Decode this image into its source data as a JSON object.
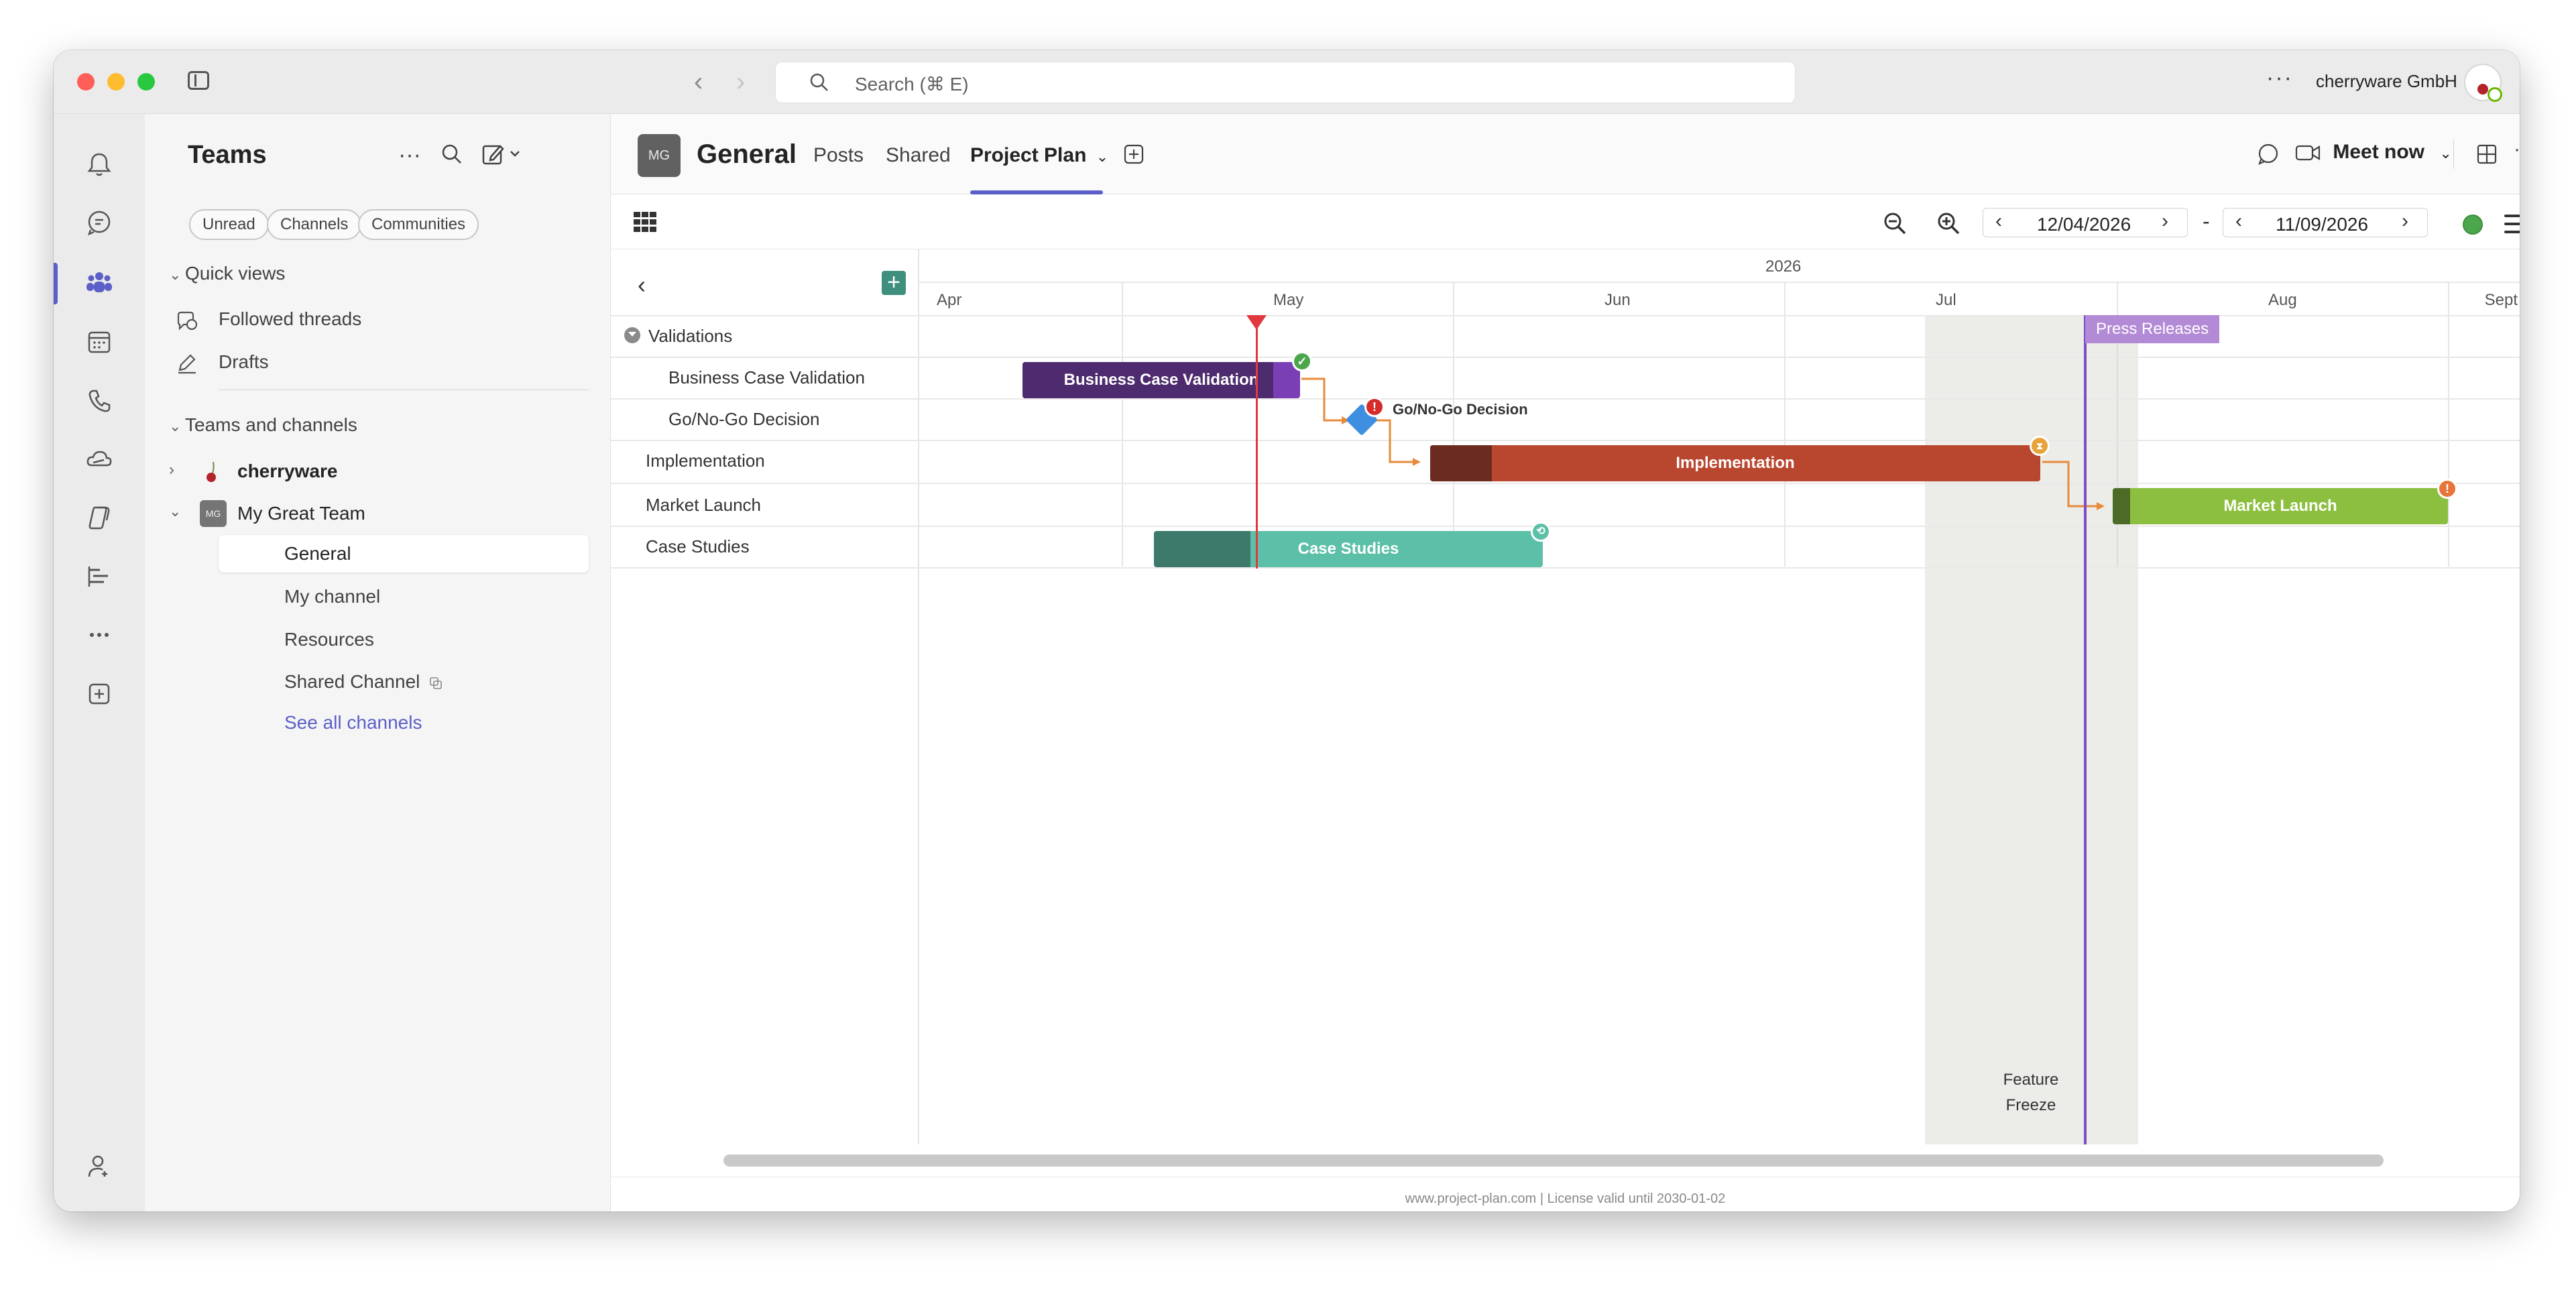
{
  "titlebar": {
    "search_placeholder": "Search (⌘ E)",
    "org_name": "cherryware GmbH",
    "more": "···"
  },
  "rail": {
    "items": [
      "Activity",
      "Chat",
      "Teams",
      "Calendar",
      "Calls",
      "OneDrive",
      "Copilot",
      "Planner",
      "More apps",
      "Apps",
      "Help"
    ],
    "active": "Teams",
    "accent": "#5b5fc7"
  },
  "teams_panel": {
    "title": "Teams",
    "filters": [
      "Unread",
      "Channels",
      "Communities"
    ],
    "quick_views": {
      "heading": "Quick views",
      "items": [
        "Followed threads",
        "Drafts"
      ]
    },
    "teams_and_channels": {
      "heading": "Teams and channels",
      "teams": [
        {
          "name": "cherryware",
          "expanded": false
        },
        {
          "name": "My Great Team",
          "badge": "MG",
          "expanded": true,
          "channels": [
            "General",
            "My channel",
            "Resources",
            "Shared Channel"
          ]
        }
      ],
      "see_all": "See all channels",
      "selected_channel": "General"
    }
  },
  "channel": {
    "avatar": "MG",
    "title": "General",
    "tabs": [
      "Posts",
      "Shared",
      "Project Plan"
    ],
    "active_tab": "Project Plan",
    "meet_now": "Meet now"
  },
  "toolbar": {
    "start_date": "12/04/2026",
    "end_date": "11/09/2026",
    "separator": "-",
    "status_color": "#4ca64c"
  },
  "gantt": {
    "year": "2026",
    "months": [
      "Apr",
      "May",
      "Jun",
      "Jul",
      "Aug",
      "Sept"
    ],
    "tasks": [
      {
        "name": "Validations",
        "type": "group"
      },
      {
        "name": "Business Case Validation",
        "type": "task",
        "bar_label": "Business Case Validation",
        "color": "#7b3fb5",
        "done_color": "#4e2a6e",
        "status": "complete"
      },
      {
        "name": "Go/No-Go Decision",
        "type": "milestone",
        "bar_label": "Go/No-Go Decision",
        "color": "#3f8fe0",
        "status": "alert"
      },
      {
        "name": "Implementation",
        "type": "task",
        "bar_label": "Implementation",
        "color": "#b9472f",
        "done_color": "#6b2b20",
        "status": "in-review"
      },
      {
        "name": "Market Launch",
        "type": "task",
        "bar_label": "Market Launch",
        "color": "#8cbf3f",
        "done_color": "#4d6b26",
        "status": "warning"
      },
      {
        "name": "Case Studies",
        "type": "task",
        "bar_label": "Case Studies",
        "color": "#5cc0a8",
        "done_color": "#3e7a6c",
        "status": "linked"
      }
    ],
    "markers": {
      "press_releases": "Press Releases",
      "feature_freeze": [
        "Feature",
        "Freeze"
      ]
    },
    "colors": {
      "today": "#e0393e",
      "press_release": "#7a4fc9",
      "dependency": "#e88a3a"
    }
  },
  "footer": {
    "license": "www.project-plan.com | License valid until 2030-01-02"
  }
}
